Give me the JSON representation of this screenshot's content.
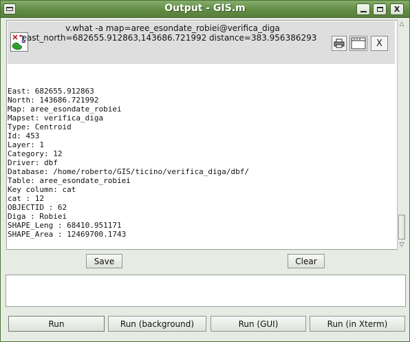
{
  "window": {
    "title": "Output - GIS.m",
    "controls": {
      "minimize": "minimize",
      "maximize": "maximize",
      "close": "X"
    }
  },
  "output": {
    "command": "v.what -a map=aree_esondate_robiei@verifica_diga",
    "query_info": "east_north=682655.912863,143686.721992 distance=383.956386293",
    "close_label": "X",
    "lines": [
      "East: 682655.912863",
      "North: 143686.721992",
      "Map: aree_esondate_robiei",
      "Mapset: verifica_diga",
      "Type: Centroid",
      "Id: 453",
      "Layer: 1",
      "Category: 12",
      "Driver: dbf",
      "Database: /home/roberto/GIS/ticino/verifica_diga/dbf/",
      "Table: aree_esondate_robiei",
      "Key column: cat",
      "cat : 12",
      "OBJECTID : 62",
      "Diga : Robiei",
      "SHAPE_Leng : 68410.951171",
      "SHAPE_Area : 12469700.1743"
    ]
  },
  "actions": {
    "save": "Save",
    "clear": "Clear"
  },
  "command_input": {
    "value": ""
  },
  "run_buttons": {
    "run": "Run",
    "run_background": "Run (background)",
    "run_gui": "Run (GUI)",
    "run_xterm": "Run (in Xterm)"
  }
}
